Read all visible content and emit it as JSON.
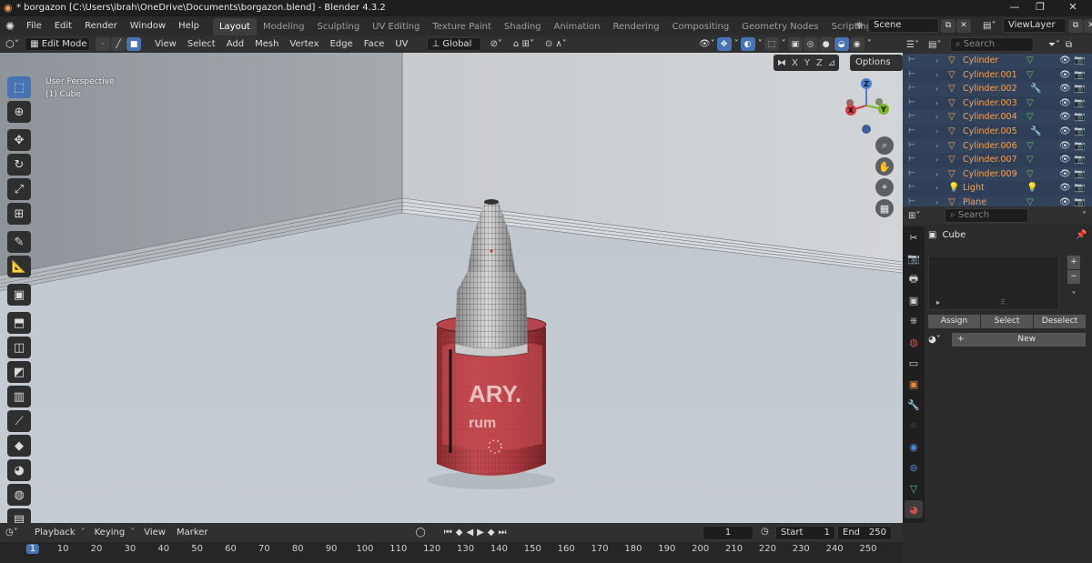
{
  "window": {
    "title": "* borgazon [C:\\Users\\ibrah\\OneDrive\\Documents\\borgazon.blend] - Blender 4.3.2"
  },
  "menu": [
    "File",
    "Edit",
    "Render",
    "Window",
    "Help"
  ],
  "workspaces": [
    "Layout",
    "Modeling",
    "Sculpting",
    "UV Editing",
    "Texture Paint",
    "Shading",
    "Animation",
    "Rendering",
    "Compositing",
    "Geometry Nodes",
    "Scripting"
  ],
  "scene": {
    "name": "Scene",
    "view_layer": "ViewLayer"
  },
  "viewport_header": {
    "mode": "Edit Mode",
    "menus": [
      "View",
      "Select",
      "Add",
      "Mesh",
      "Vertex",
      "Edge",
      "Face",
      "UV"
    ],
    "orientation": "Global",
    "axes": [
      "X",
      "Y",
      "Z"
    ],
    "options_label": "Options"
  },
  "viewport": {
    "perspective": "User Perspective",
    "object": "(1) Cube",
    "gizmo_axes": [
      "Z",
      "X",
      "Y"
    ],
    "label_text": [
      "ARY.",
      "rum"
    ]
  },
  "outliner": {
    "search_placeholder": "Search",
    "items": [
      {
        "name": "Cylinder"
      },
      {
        "name": "Cylinder.001"
      },
      {
        "name": "Cylinder.002"
      },
      {
        "name": "Cylinder.003"
      },
      {
        "name": "Cylinder.004"
      },
      {
        "name": "Cylinder.005"
      },
      {
        "name": "Cylinder.006"
      },
      {
        "name": "Cylinder.007"
      },
      {
        "name": "Cylinder.009"
      },
      {
        "name": "Light"
      },
      {
        "name": "Plane"
      }
    ]
  },
  "properties": {
    "search_placeholder": "Search",
    "object_name": "Cube",
    "buttons": {
      "assign": "Assign",
      "select": "Select",
      "deselect": "Deselect",
      "new": "New"
    }
  },
  "timeline": {
    "menus": [
      "Playback",
      "Keying",
      "View",
      "Marker"
    ],
    "current_frame": "1",
    "start_label": "Start",
    "start": "1",
    "end_label": "End",
    "end": "250",
    "ruler": [
      "1",
      "10",
      "20",
      "30",
      "40",
      "50",
      "60",
      "70",
      "80",
      "90",
      "100",
      "110",
      "120",
      "130",
      "140",
      "150",
      "160",
      "170",
      "180",
      "190",
      "200",
      "210",
      "220",
      "230",
      "240",
      "250"
    ]
  },
  "colors": {
    "accent": "#4772b3",
    "object_orange": "#f0a35a",
    "bottle_red": "#b2383d"
  }
}
